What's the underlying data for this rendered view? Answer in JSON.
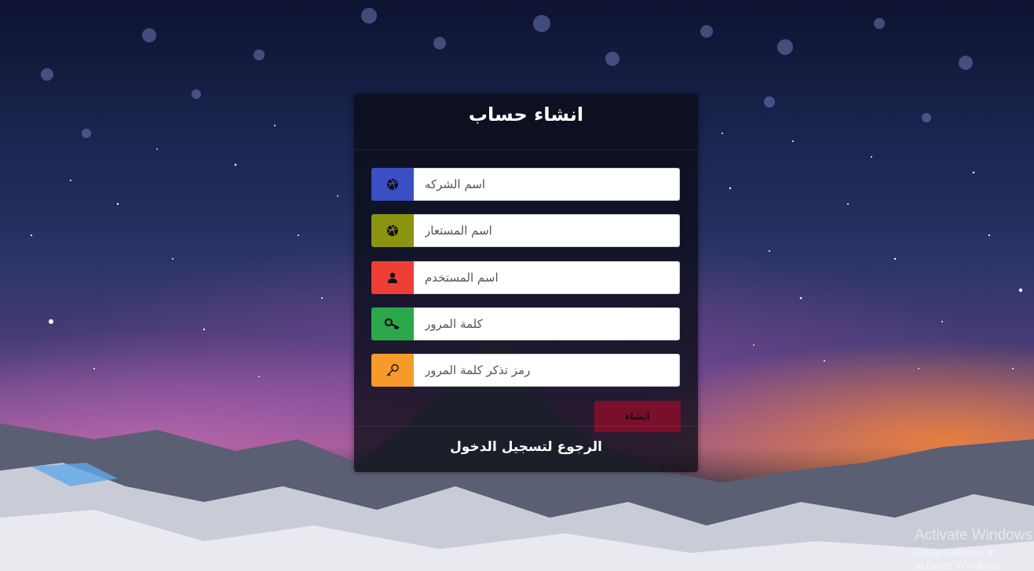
{
  "form": {
    "title": "انشاء حساب",
    "fields": [
      {
        "placeholder": "اسم الشركه",
        "icon": "dribbble-icon",
        "color": "#3b4fc4"
      },
      {
        "placeholder": "اسم المستعار",
        "icon": "dribbble-icon",
        "color": "#8a9410"
      },
      {
        "placeholder": "اسم المستخدم",
        "icon": "user-icon",
        "color": "#ef3e36"
      },
      {
        "placeholder": "كلمة المرور",
        "icon": "key-icon",
        "color": "#2aa84a"
      },
      {
        "placeholder": "رمز تذكر كلمة المرور",
        "icon": "key-outline-icon",
        "color": "#f59a2b"
      }
    ],
    "submit_label": "انشاء",
    "submit_color": "#7a0f2b",
    "back_link": "الرجوع لتسجيل الدخول"
  },
  "watermark": {
    "line1": "Activate Windows",
    "line2": "Go to Settings to activate Windows."
  }
}
